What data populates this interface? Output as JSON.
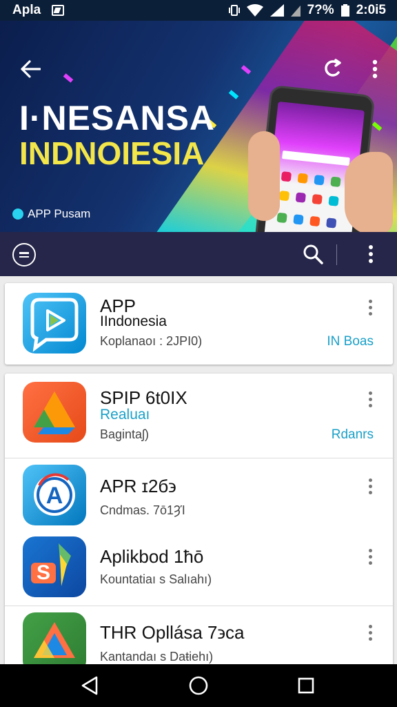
{
  "status_bar": {
    "app_name": "Apla",
    "battery": "7?%",
    "time": "2:0і5"
  },
  "hero": {
    "title": "I·NESANSA",
    "subtitle": "INDNOΙESIA",
    "badge": "APP Pusam",
    "colors": {
      "title": "#ffffff",
      "subtitle": "#f2e64a"
    }
  },
  "toolbar": {
    "menu_icon": "menu-circle-icon",
    "search_icon": "search-icon",
    "more_icon": "more-vert-icon"
  },
  "featured": {
    "title": "APP",
    "subtitle": "IIndonesia",
    "meta": "Koplanaoı : 2ЈPI0)",
    "action": "IN Boas"
  },
  "apps": [
    {
      "title": "SPIP 6t0IX",
      "subtitle": "Realuaı",
      "meta": "Bagintaʃ)",
      "action": "Rdanrs"
    },
    {
      "title": "APR ɪ2б϶",
      "meta": "Cndmas. 7ō1ȜΊ"
    },
    {
      "title": "Aplikbod 1ћō",
      "meta": "Kountatiaı s Salıahı)"
    },
    {
      "title": "THR Opllása 7϶ca",
      "meta": "Kantandaı s Daŧiehı)"
    }
  ],
  "nav": {
    "back_icon": "nav-back-icon",
    "home_icon": "nav-home-icon",
    "recents_icon": "nav-recents-icon"
  },
  "accent": "#1aa0c8"
}
